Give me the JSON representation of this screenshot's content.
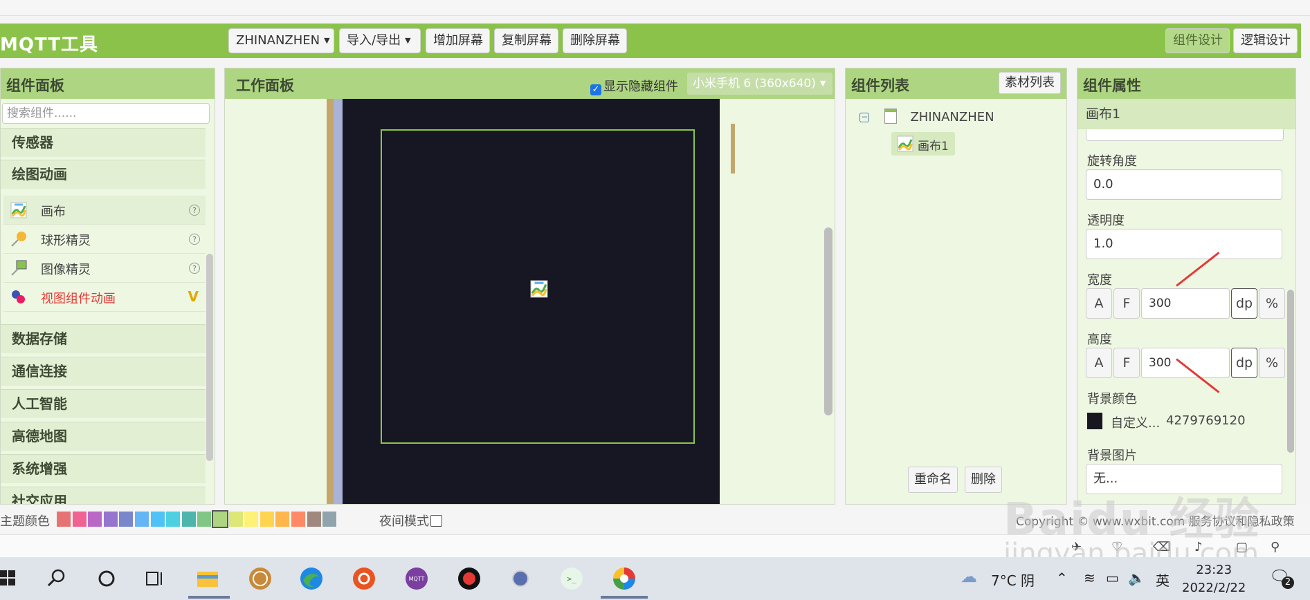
{
  "header": {
    "app_title": "MQTT工具",
    "project_name": "ZHINANZHEN",
    "import_export": "导入/导出",
    "add_screen": "增加屏幕",
    "copy_screen": "复制屏幕",
    "delete_screen": "删除屏幕",
    "designer": "组件设计",
    "blocks": "逻辑设计"
  },
  "palette": {
    "title": "组件面板",
    "search_placeholder": "搜索组件......",
    "categories": [
      "传感器",
      "绘图动画",
      "数据存储",
      "通信连接",
      "人工智能",
      "高德地图",
      "系统增强",
      "社交应用"
    ],
    "items": [
      {
        "label": "画布",
        "icon": "canvas-icon"
      },
      {
        "label": "球形精灵",
        "icon": "ball-sprite-icon"
      },
      {
        "label": "图像精灵",
        "icon": "image-sprite-icon"
      },
      {
        "label": "视图组件动画",
        "icon": "view-animation-icon",
        "badge": "V"
      }
    ]
  },
  "viewer": {
    "title": "工作面板",
    "show_hidden": "显示隐藏组件",
    "device": "小米手机 6 (360x640)"
  },
  "tree": {
    "title": "组件列表",
    "assets_button": "素材列表",
    "root": "ZHINANZHEN",
    "child": "画布1",
    "rename": "重命名",
    "delete": "删除"
  },
  "props": {
    "title": "组件属性",
    "component": "画布1",
    "rotation_label": "旋转角度",
    "rotation_value": "0.0",
    "alpha_label": "透明度",
    "alpha_value": "1.0",
    "width_label": "宽度",
    "width_value": "300",
    "height_label": "高度",
    "height_value": "300",
    "unit_a": "A",
    "unit_f": "F",
    "unit_dp": "dp",
    "unit_pct": "%",
    "bg_color_label": "背景颜色",
    "bg_color_name": "自定义...",
    "bg_color_value": "4279769120",
    "bg_image_label": "背景图片",
    "bg_image_value": "无..."
  },
  "footer": {
    "theme_label": "主题颜色",
    "theme_colors": [
      "#e57373",
      "#f06292",
      "#ba68c8",
      "#9575cd",
      "#7986cb",
      "#64b5f6",
      "#4fc3f7",
      "#4dd0e1",
      "#4db6ac",
      "#81c784",
      "#aed581",
      "#dce775",
      "#fff176",
      "#ffd54f",
      "#ffb74d",
      "#ff8a65",
      "#a1887f",
      "#90a4ae"
    ],
    "night_mode": "夜间模式",
    "copyright": "Copyright © www.wxbit.com 服务协议和隐私政策"
  },
  "taskbar": {
    "weather": "7°C 阴",
    "ime": "英",
    "time": "23:23",
    "date": "2022/2/22",
    "notifications": "2"
  },
  "watermark": {
    "brand": "Baidu 经验",
    "site": "jingyan.baidu.com"
  }
}
